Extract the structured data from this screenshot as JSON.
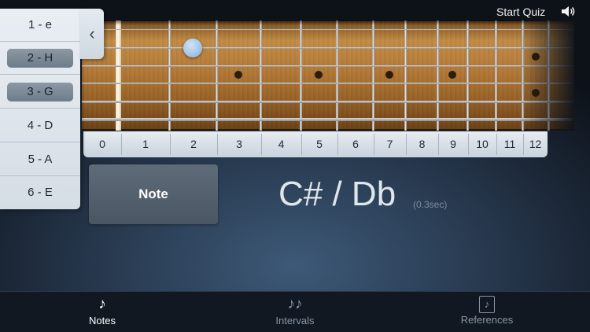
{
  "header": {
    "start_quiz": "Start Quiz",
    "sound_icon": "speaker-icon"
  },
  "string_panel": {
    "toggle_icon": "chevron-left-icon",
    "toggle_glyph": "‹",
    "items": [
      {
        "label": "1 - e",
        "selected": false
      },
      {
        "label": "2 - H",
        "selected": true
      },
      {
        "label": "3 - G",
        "selected": true
      },
      {
        "label": "4 - D",
        "selected": false
      },
      {
        "label": "5 - A",
        "selected": false
      },
      {
        "label": "6 - E",
        "selected": false
      }
    ]
  },
  "fretboard": {
    "fret_numbers": [
      "0",
      "1",
      "2",
      "3",
      "4",
      "5",
      "6",
      "7",
      "8",
      "9",
      "10",
      "11",
      "12"
    ],
    "inlay_frets": [
      3,
      5,
      7,
      9,
      12
    ],
    "highlight": {
      "string": 2,
      "fret": 2
    }
  },
  "main": {
    "note_button": "Note",
    "note_name": "C# / Db",
    "response_time": "(0.3sec)"
  },
  "tabs": [
    {
      "label": "Notes",
      "icon": "note-icon",
      "glyph": "♪",
      "active": true
    },
    {
      "label": "Intervals",
      "icon": "two-notes-icon",
      "glyph": "♪♪",
      "active": false
    },
    {
      "label": "References",
      "icon": "music-sheet-icon",
      "glyph": "♪",
      "active": false
    }
  ],
  "colors": {
    "background": "#283a50",
    "marker": "#9bbfe4",
    "selected_pill": "#7b8895",
    "tab_active": "#ffffff",
    "tab_inactive": "#8796a6"
  }
}
